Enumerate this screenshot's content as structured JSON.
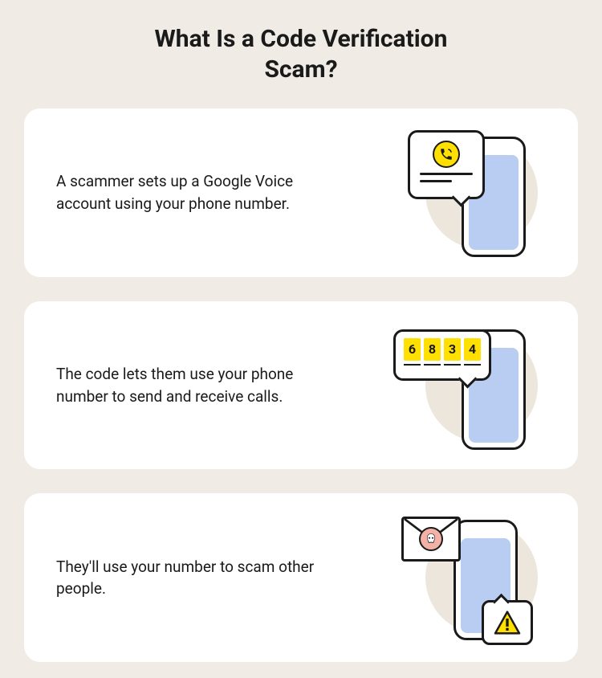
{
  "title": "What Is a Code Verification Scam?",
  "cards": [
    {
      "text": "A scammer sets up a Google Voice account using your phone number."
    },
    {
      "text": "The code lets them use your phone number to send and receive calls.",
      "code": [
        "6",
        "8",
        "3",
        "4"
      ]
    },
    {
      "text": "They'll use your number to scam other people."
    }
  ]
}
